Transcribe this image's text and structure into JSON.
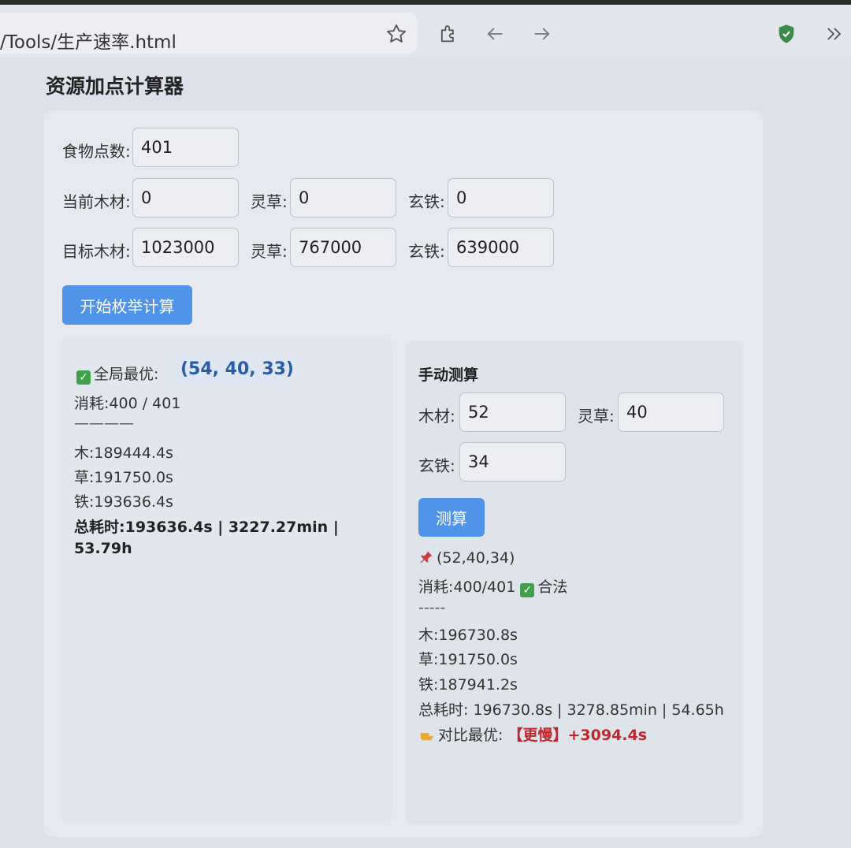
{
  "browser": {
    "url": "/Tools/生产速率.html",
    "icons": [
      "star-icon",
      "extension-icon",
      "back-icon",
      "forward-icon",
      "shield-icon",
      "overflow-icon"
    ]
  },
  "app": {
    "title": "资源加点计算器"
  },
  "form": {
    "food_label": "食物点数:",
    "food_value": "401",
    "current_wood_label": "当前木材:",
    "current_wood_value": "0",
    "current_herb_label": "灵草:",
    "current_herb_value": "0",
    "current_iron_label": "玄铁:",
    "current_iron_value": "0",
    "target_wood_label": "目标木材:",
    "target_wood_value": "1023000",
    "target_herb_label": "灵草:",
    "target_herb_value": "767000",
    "target_iron_label": "玄铁:",
    "target_iron_value": "639000",
    "enumerate_button": "开始枚举计算"
  },
  "best": {
    "label": "全局最优:",
    "value": "(54, 40, 33)",
    "consumption": "消耗:400 / 401",
    "divider": "————",
    "wood": "木:189444.4s",
    "herb": "草:191750.0s",
    "iron": "铁:193636.4s",
    "total_line1": "总耗时:193636.4s | 3227.27min |",
    "total_line2": "53.79h"
  },
  "manual": {
    "title": "手动测算",
    "wood_label": "木材:",
    "wood_value": "52",
    "herb_label": "灵草:",
    "herb_value": "40",
    "iron_label": "玄铁:",
    "iron_value": "34",
    "calc_button": "测算",
    "result_tuple": "(52,40,34)",
    "consumption": "消耗:400/401",
    "legal": "合法",
    "divider": "-----",
    "wood": "木:196730.8s",
    "herb": "草:191750.0s",
    "iron": "铁:187941.2s",
    "total": "总耗时: 196730.8s | 3278.85min | 54.65h",
    "compare_label": "对比最优:",
    "compare_result": "【更慢】+3094.4s"
  },
  "colors": {
    "accent": "#4f94e8",
    "best_value": "#2a5da8",
    "slower": "#c0282d",
    "check": "#3fa14a"
  }
}
